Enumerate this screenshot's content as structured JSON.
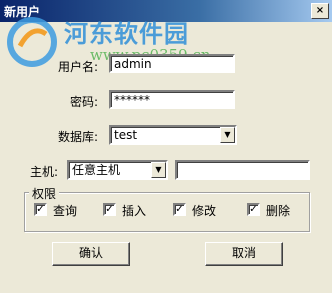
{
  "window": {
    "title": "新用户",
    "close_glyph": "×"
  },
  "watermark": {
    "text": "河东软件园",
    "url": "www.pc0359.cn"
  },
  "form": {
    "username_label": "用户名:",
    "username_value": "admin",
    "password_label": "密码:",
    "password_value": "******",
    "database_label": "数据库:",
    "database_value": "test",
    "host_label": "主机:",
    "host_value": "任意主机",
    "host_input_value": "",
    "dropdown_glyph": "▼"
  },
  "permissions": {
    "title": "权限",
    "items": [
      {
        "label": "查询",
        "checked": true
      },
      {
        "label": "插入",
        "checked": true
      },
      {
        "label": "修改",
        "checked": true
      },
      {
        "label": "删除",
        "checked": true
      }
    ],
    "check_glyph": "✓"
  },
  "buttons": {
    "ok_label": "确认",
    "cancel_label": "取消"
  }
}
